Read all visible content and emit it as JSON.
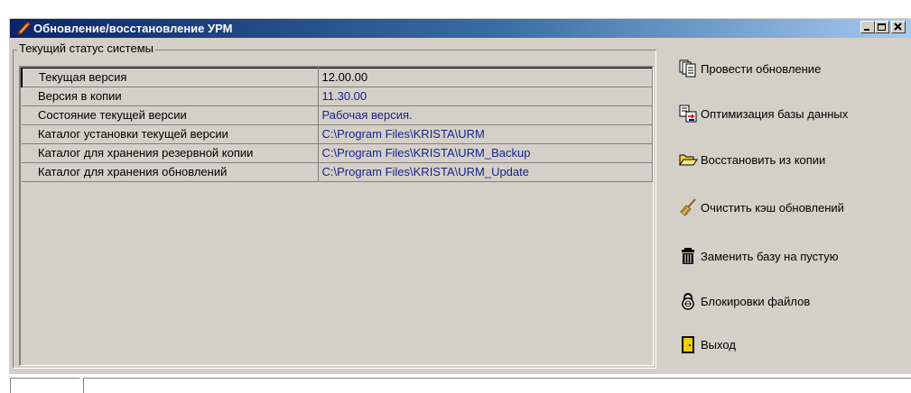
{
  "window": {
    "title": "Обновление/восстановление УРМ"
  },
  "status_group": {
    "label": "Текущий статус системы",
    "rows": [
      {
        "key": "Текущая версия",
        "value": "12.00.00"
      },
      {
        "key": "Версия в копии",
        "value": "11.30.00"
      },
      {
        "key": "Состояние текущей версии",
        "value": "Рабочая версия."
      },
      {
        "key": "Каталог установки текущей версии",
        "value": "C:\\Program Files\\KRISTA\\URM"
      },
      {
        "key": "Каталог для хранения резервной копии",
        "value": "C:\\Program Files\\KRISTA\\URM_Backup"
      },
      {
        "key": "Каталог для хранения обновлений",
        "value": "C:\\Program Files\\KRISTA\\URM_Update"
      }
    ]
  },
  "actions": [
    {
      "label": "Провести обновление",
      "icon": "copy-pages-icon"
    },
    {
      "label": "Оптимизация базы данных",
      "icon": "database-optimize-icon"
    },
    {
      "label": "Восстановить из копии",
      "icon": "open-folder-icon"
    },
    {
      "label": "Очистить кэш обновлений",
      "icon": "broom-icon"
    },
    {
      "label": "Заменить базу на пустую",
      "icon": "trash-can-icon"
    },
    {
      "label": "Блокировки файлов",
      "icon": "padlock-icon"
    },
    {
      "label": "Выход",
      "icon": "exit-door-icon"
    }
  ],
  "colors": {
    "title_start": "#0a246a",
    "title_end": "#a6caf0",
    "value_text": "#16248e",
    "face": "#d4d0c8"
  }
}
